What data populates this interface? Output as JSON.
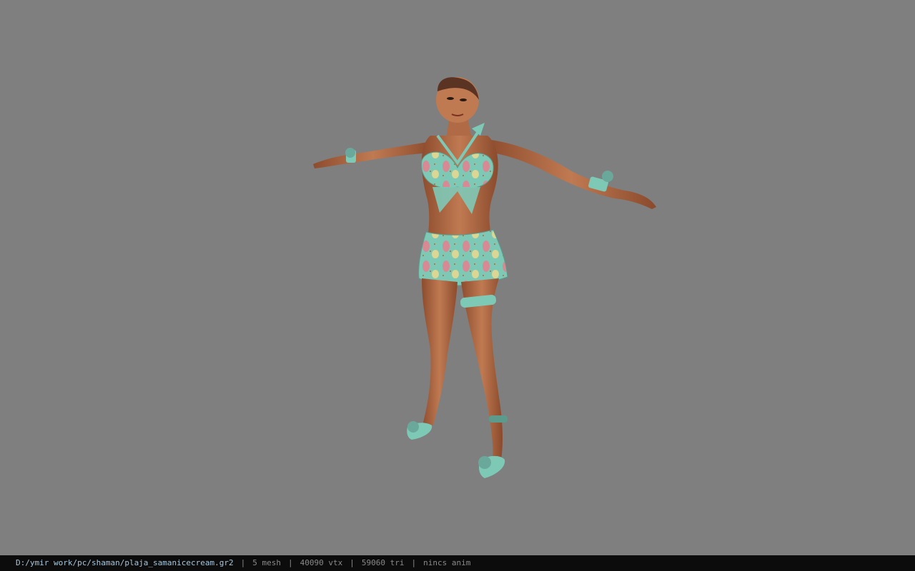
{
  "viewer": {
    "background_color": "#7f7f7f",
    "model_subject": "t-pose female character in teal ice-cream patterned bikini and skirt"
  },
  "statusbar": {
    "file_path": "D:/ymir work/pc/shaman/plaja_samanicecream.gr2",
    "mesh": "5 mesh",
    "vtx": "40090 vtx",
    "tri": "59060 tri",
    "anim": "nincs anim",
    "separator": "|"
  },
  "colors": {
    "skin": "#b66b45",
    "skin_shadow": "#8a4a2c",
    "outfit": "#7ec9b6",
    "outfit_accent": "#e77e8e",
    "hair": "#3a2418"
  }
}
